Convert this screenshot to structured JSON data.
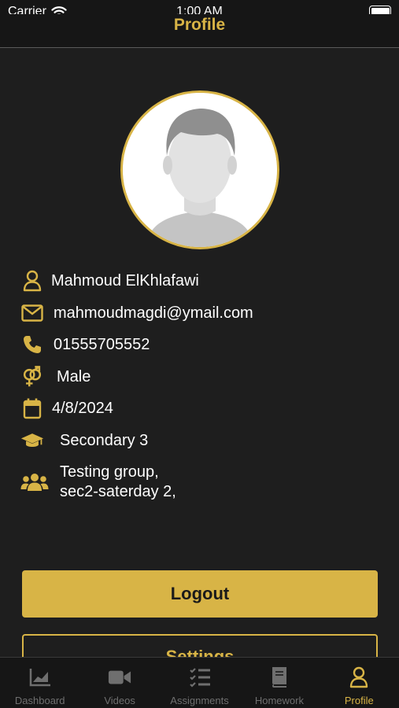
{
  "status_bar": {
    "carrier": "Carrier",
    "time": "1:00 AM"
  },
  "header": {
    "title": "Profile"
  },
  "profile": {
    "name": "Mahmoud ElKhlafawi",
    "email": "mahmoudmagdi@ymail.com",
    "phone": "01555705552",
    "gender": "Male",
    "date": "4/8/2024",
    "grade": "Secondary 3",
    "groups_line1": "Testing group,",
    "groups_line2": "sec2-saterday 2,"
  },
  "buttons": {
    "logout": "Logout",
    "settings": "Settings"
  },
  "tabs": [
    {
      "label": "Dashboard",
      "icon": "chart-icon"
    },
    {
      "label": "Videos",
      "icon": "video-icon"
    },
    {
      "label": "Assignments",
      "icon": "checklist-icon"
    },
    {
      "label": "Homework",
      "icon": "book-icon"
    },
    {
      "label": "Profile",
      "icon": "user-icon",
      "active": true
    }
  ],
  "colors": {
    "accent": "#d8b446",
    "background": "#1e1e1e",
    "bar": "#161616",
    "inactive": "#6f6f6f"
  }
}
